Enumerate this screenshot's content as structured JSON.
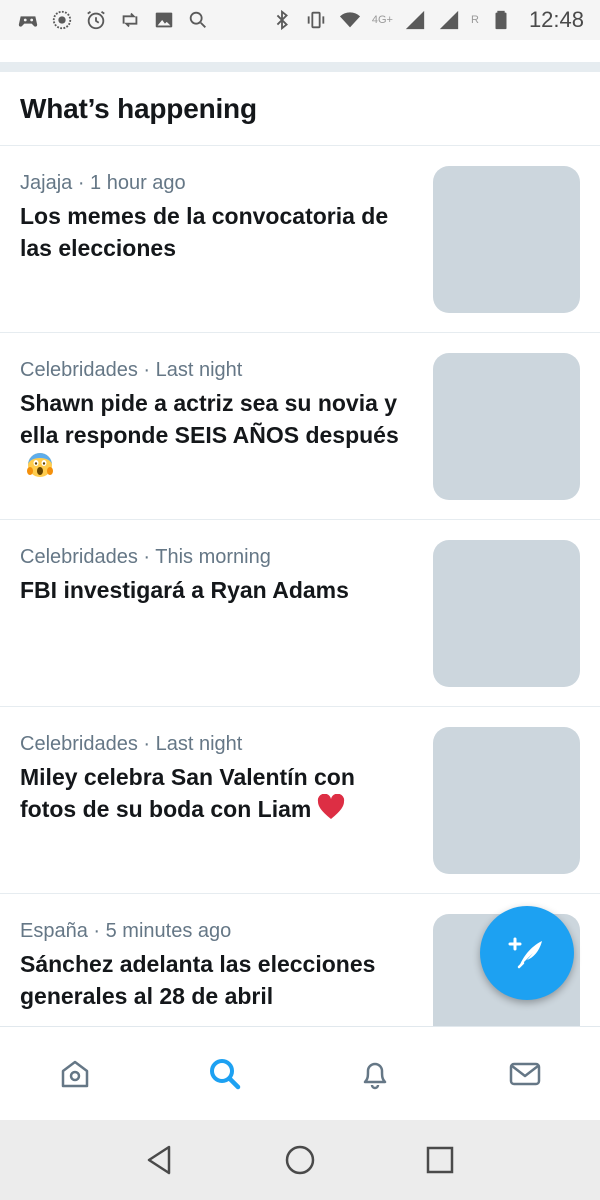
{
  "status_bar": {
    "time": "12:48",
    "network": "4G+",
    "roaming": "R",
    "icons": [
      "game-icon",
      "lion-icon",
      "alarm-icon",
      "retweet-icon",
      "image-icon",
      "search-icon",
      "bluetooth-icon",
      "vibrate-icon",
      "wifi-icon",
      "signal-icon",
      "signal-icon",
      "battery-icon"
    ]
  },
  "section": {
    "title": "What’s happening"
  },
  "trends": [
    {
      "meta": "Jajaja · 1 hour ago",
      "title": "Los memes de la convocatoria de las elecciones",
      "emoji": ""
    },
    {
      "meta": "Celebridades · Last night",
      "title": "Shawn pide a actriz sea su novia y ella responde SEIS AÑOS después",
      "emoji": "screaming-face-emoji"
    },
    {
      "meta": "Celebridades · This morning",
      "title": "FBI investigará a Ryan Adams",
      "emoji": ""
    },
    {
      "meta": "Celebridades · Last night",
      "title": "Miley celebra San Valentín con fotos de su boda con Liam",
      "emoji": "red-heart-emoji"
    },
    {
      "meta": "España · 5 minutes ago",
      "title": "Sánchez adelanta las elecciones generales al 28 de abril",
      "emoji": ""
    }
  ],
  "fab": {
    "icon": "compose-tweet-icon"
  },
  "tab_bar": {
    "active": "search",
    "tabs": [
      "home",
      "search",
      "notifications",
      "messages"
    ]
  },
  "colors": {
    "accent": "#1da1f2",
    "text_primary": "#14171a",
    "text_secondary": "#657786",
    "divider": "#e6ecf0",
    "thumb": "#ccd6dd",
    "heart": "#e0245e"
  }
}
